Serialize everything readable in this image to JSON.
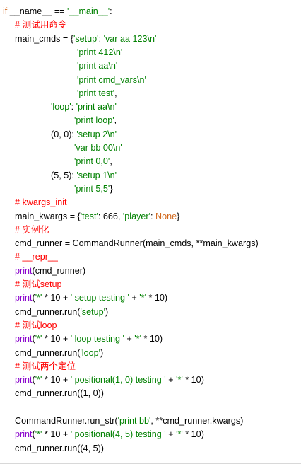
{
  "colors": {
    "keyword": "#d2691e",
    "string": "#008000",
    "comment": "#ff0000",
    "builtin": "#8800cc",
    "plain": "#000000",
    "background": "#ffffff"
  },
  "code": {
    "lines": [
      {
        "indent": 4,
        "tokens": [
          {
            "t": "if",
            "k": "kw"
          },
          {
            "t": " __name__ == ",
            "k": "plain"
          },
          {
            "t": "'__main__'",
            "k": "str"
          },
          {
            "t": ":",
            "k": "plain"
          }
        ]
      },
      {
        "indent": 21,
        "tokens": [
          {
            "t": "# 测试用命令",
            "k": "cm"
          }
        ]
      },
      {
        "indent": 21,
        "tokens": [
          {
            "t": "main_cmds = {",
            "k": "plain"
          },
          {
            "t": "'setup'",
            "k": "str"
          },
          {
            "t": ": ",
            "k": "plain"
          },
          {
            "t": "'var aa 123\\n'",
            "k": "str"
          }
        ]
      },
      {
        "indent": 109,
        "tokens": [
          {
            "t": "'print 412\\n'",
            "k": "str"
          }
        ]
      },
      {
        "indent": 109,
        "tokens": [
          {
            "t": "'print aa\\n'",
            "k": "str"
          }
        ]
      },
      {
        "indent": 109,
        "tokens": [
          {
            "t": "'print cmd_vars\\n'",
            "k": "str"
          }
        ]
      },
      {
        "indent": 109,
        "tokens": [
          {
            "t": "'print test'",
            "k": "str"
          },
          {
            "t": ",",
            "k": "plain"
          }
        ]
      },
      {
        "indent": 72,
        "tokens": [
          {
            "t": "'loop'",
            "k": "str"
          },
          {
            "t": ": ",
            "k": "plain"
          },
          {
            "t": "'print aa\\n'",
            "k": "str"
          }
        ]
      },
      {
        "indent": 105,
        "tokens": [
          {
            "t": "'print loop'",
            "k": "str"
          },
          {
            "t": ",",
            "k": "plain"
          }
        ]
      },
      {
        "indent": 72,
        "tokens": [
          {
            "t": "(0, 0): ",
            "k": "plain"
          },
          {
            "t": "'setup 2\\n'",
            "k": "str"
          }
        ]
      },
      {
        "indent": 105,
        "tokens": [
          {
            "t": "'var bb 00\\n'",
            "k": "str"
          }
        ]
      },
      {
        "indent": 105,
        "tokens": [
          {
            "t": "'print 0,0'",
            "k": "str"
          },
          {
            "t": ",",
            "k": "plain"
          }
        ]
      },
      {
        "indent": 72,
        "tokens": [
          {
            "t": "(5, 5): ",
            "k": "plain"
          },
          {
            "t": "'setup 1\\n'",
            "k": "str"
          }
        ]
      },
      {
        "indent": 105,
        "tokens": [
          {
            "t": "'print 5,5'",
            "k": "str"
          },
          {
            "t": "}",
            "k": "plain"
          }
        ]
      },
      {
        "indent": 21,
        "tokens": [
          {
            "t": "# kwargs_init",
            "k": "cm"
          }
        ]
      },
      {
        "indent": 21,
        "tokens": [
          {
            "t": "main_kwargs = {",
            "k": "plain"
          },
          {
            "t": "'test'",
            "k": "str"
          },
          {
            "t": ": 666, ",
            "k": "plain"
          },
          {
            "t": "'player'",
            "k": "str"
          },
          {
            "t": ": ",
            "k": "plain"
          },
          {
            "t": "None",
            "k": "kw"
          },
          {
            "t": "}",
            "k": "plain"
          }
        ]
      },
      {
        "indent": 21,
        "tokens": [
          {
            "t": "# 实例化",
            "k": "cm"
          }
        ]
      },
      {
        "indent": 21,
        "tokens": [
          {
            "t": "cmd_runner = CommandRunner(main_cmds, **main_kwargs)",
            "k": "plain"
          }
        ]
      },
      {
        "indent": 21,
        "tokens": [
          {
            "t": "# __repr__",
            "k": "cm"
          }
        ]
      },
      {
        "indent": 21,
        "tokens": [
          {
            "t": "print",
            "k": "fn"
          },
          {
            "t": "(cmd_runner)",
            "k": "plain"
          }
        ]
      },
      {
        "indent": 21,
        "tokens": [
          {
            "t": "# 测试setup",
            "k": "cm"
          }
        ]
      },
      {
        "indent": 21,
        "tokens": [
          {
            "t": "print",
            "k": "fn"
          },
          {
            "t": "(",
            "k": "plain"
          },
          {
            "t": "'*'",
            "k": "str"
          },
          {
            "t": " * 10 + ",
            "k": "plain"
          },
          {
            "t": "' setup testing '",
            "k": "str"
          },
          {
            "t": " + ",
            "k": "plain"
          },
          {
            "t": "'*'",
            "k": "str"
          },
          {
            "t": " * 10)",
            "k": "plain"
          }
        ]
      },
      {
        "indent": 21,
        "tokens": [
          {
            "t": "cmd_runner.run(",
            "k": "plain"
          },
          {
            "t": "'setup'",
            "k": "str"
          },
          {
            "t": ")",
            "k": "plain"
          }
        ]
      },
      {
        "indent": 21,
        "tokens": [
          {
            "t": "# 测试loop",
            "k": "cm"
          }
        ]
      },
      {
        "indent": 21,
        "tokens": [
          {
            "t": "print",
            "k": "fn"
          },
          {
            "t": "(",
            "k": "plain"
          },
          {
            "t": "'*'",
            "k": "str"
          },
          {
            "t": " * 10 + ",
            "k": "plain"
          },
          {
            "t": "' loop testing '",
            "k": "str"
          },
          {
            "t": " + ",
            "k": "plain"
          },
          {
            "t": "'*'",
            "k": "str"
          },
          {
            "t": " * 10)",
            "k": "plain"
          }
        ]
      },
      {
        "indent": 21,
        "tokens": [
          {
            "t": "cmd_runner.run(",
            "k": "plain"
          },
          {
            "t": "'loop'",
            "k": "str"
          },
          {
            "t": ")",
            "k": "plain"
          }
        ]
      },
      {
        "indent": 21,
        "tokens": [
          {
            "t": "# 测试两个定位",
            "k": "cm"
          }
        ]
      },
      {
        "indent": 21,
        "tokens": [
          {
            "t": "print",
            "k": "fn"
          },
          {
            "t": "(",
            "k": "plain"
          },
          {
            "t": "'*'",
            "k": "str"
          },
          {
            "t": " * 10 + ",
            "k": "plain"
          },
          {
            "t": "' positional(1, 0) testing '",
            "k": "str"
          },
          {
            "t": " + ",
            "k": "plain"
          },
          {
            "t": "'*'",
            "k": "str"
          },
          {
            "t": " * 10)",
            "k": "plain"
          }
        ]
      },
      {
        "indent": 21,
        "tokens": [
          {
            "t": "cmd_runner.run((1, 0))",
            "k": "plain"
          }
        ]
      },
      {
        "indent": 21,
        "tokens": []
      },
      {
        "indent": 21,
        "tokens": [
          {
            "t": "CommandRunner.run_str(",
            "k": "plain"
          },
          {
            "t": "'print bb'",
            "k": "str"
          },
          {
            "t": ", **cmd_runner.kwargs)",
            "k": "plain"
          }
        ]
      },
      {
        "indent": 21,
        "tokens": [
          {
            "t": "print",
            "k": "fn"
          },
          {
            "t": "(",
            "k": "plain"
          },
          {
            "t": "'*'",
            "k": "str"
          },
          {
            "t": " * 10 + ",
            "k": "plain"
          },
          {
            "t": "' positional(4, 5) testing '",
            "k": "str"
          },
          {
            "t": " + ",
            "k": "plain"
          },
          {
            "t": "'*'",
            "k": "str"
          },
          {
            "t": " * 10)",
            "k": "plain"
          }
        ]
      },
      {
        "indent": 21,
        "tokens": [
          {
            "t": "cmd_runner.run((4, 5))",
            "k": "plain"
          }
        ]
      }
    ]
  }
}
